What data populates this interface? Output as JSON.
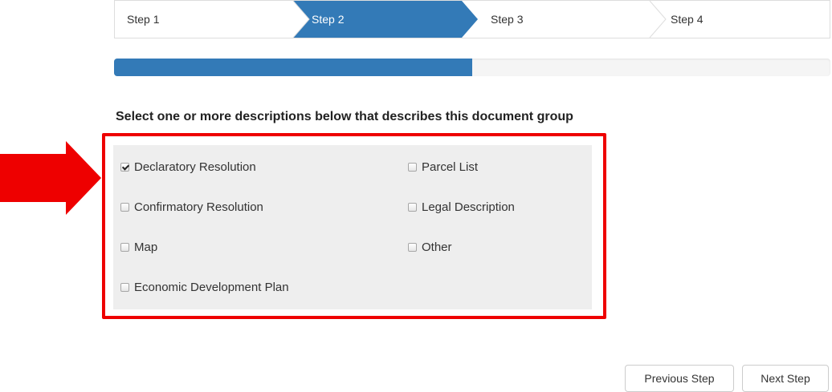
{
  "wizard": {
    "steps": [
      {
        "label": "Step 1",
        "state": "inactive"
      },
      {
        "label": "Step 2",
        "state": "active"
      },
      {
        "label": "Step 3",
        "state": "inactive"
      },
      {
        "label": "Step 4",
        "state": "inactive"
      }
    ],
    "progress_percent": 50
  },
  "form": {
    "heading": "Select one or more descriptions below that describes this document group",
    "options": [
      {
        "label": "Declaratory Resolution",
        "checked": true
      },
      {
        "label": "Parcel List",
        "checked": false
      },
      {
        "label": "Confirmatory Resolution",
        "checked": false
      },
      {
        "label": "Legal Description",
        "checked": false
      },
      {
        "label": "Map",
        "checked": false
      },
      {
        "label": "Other",
        "checked": false
      },
      {
        "label": "Economic Development Plan",
        "checked": false
      }
    ]
  },
  "actions": {
    "previous_label": "Previous Step",
    "next_label": "Next Step"
  },
  "colors": {
    "active_step": "#337ab7",
    "progress_fill": "#337ab7",
    "highlight_border": "#ee0000",
    "annotation_arrow": "#ee0000",
    "panel_background": "#eeeeee"
  },
  "annotation": {
    "icon": "right-arrow-icon"
  }
}
